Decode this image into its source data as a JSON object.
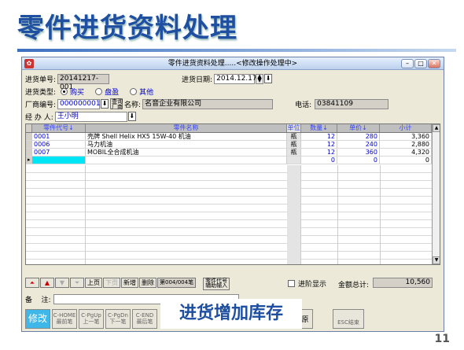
{
  "slide": {
    "title": "零件进货资料处理",
    "page": "11",
    "overlay_text": "进货增加库存"
  },
  "window": {
    "title": "零件进货资料处理.....<修改操作处理中>"
  },
  "form": {
    "order_label": "进货单号:",
    "order_value": "20141217-001",
    "date_label": "进货日期:",
    "date_value": "2014.12.17",
    "type_label": "进货类型:",
    "type_options": [
      "购买",
      "盘盈",
      "其他"
    ],
    "type_selected": "购买",
    "vendor_label": "厂商编号:",
    "vendor_value": "0000000010",
    "vendor_query": "查询\n厂商",
    "name_label": "名称:",
    "name_value": "名音企业有限公司",
    "phone_label": "电话:",
    "phone_value": "03841109",
    "handler_label": "经 办 人:",
    "handler_value": "王小明"
  },
  "grid": {
    "headers": [
      "零件代号↓",
      "零件名称",
      "单位",
      "数量↓",
      "单价↓",
      "小计"
    ],
    "rows": [
      {
        "code": "0001",
        "name": "壳牌 Shell Helix HX5 15W-40 机油",
        "unit": "瓶",
        "qty": "12",
        "price": "280",
        "subtotal": "3,360"
      },
      {
        "code": "0006",
        "name": "马力机油",
        "unit": "瓶",
        "qty": "12",
        "price": "240",
        "subtotal": "2,880"
      },
      {
        "code": "0007",
        "name": "MOBIL全合成机油",
        "unit": "瓶",
        "qty": "12",
        "price": "360",
        "subtotal": "4,320"
      },
      {
        "code": "",
        "name": "",
        "unit": "",
        "qty": "0",
        "price": "0",
        "subtotal": "0"
      }
    ]
  },
  "nav": {
    "first": "⏶",
    "prev": "▲",
    "next": "▼",
    "last": "⏷",
    "page_up": "上页",
    "page_down": "下页",
    "new_row": "新增",
    "delete_row": "删除",
    "record": "第004/004笔",
    "part_code_assist": "零件代号\n辅助输入",
    "advanced_label": "进阶显示",
    "total_label": "金额总计:",
    "total_value": "10,560"
  },
  "remark": {
    "label": "备    注:",
    "value": ""
  },
  "buttons": {
    "modify": "修改",
    "first_rec": "C-HOME\n最前笔",
    "prev_rec": "C-PgUp\n上一笔",
    "next_rec": "C-PgDn\n下一笔",
    "last_rec": "C-END\n最后笔",
    "restore": "原",
    "exit": "ESC结束"
  }
}
